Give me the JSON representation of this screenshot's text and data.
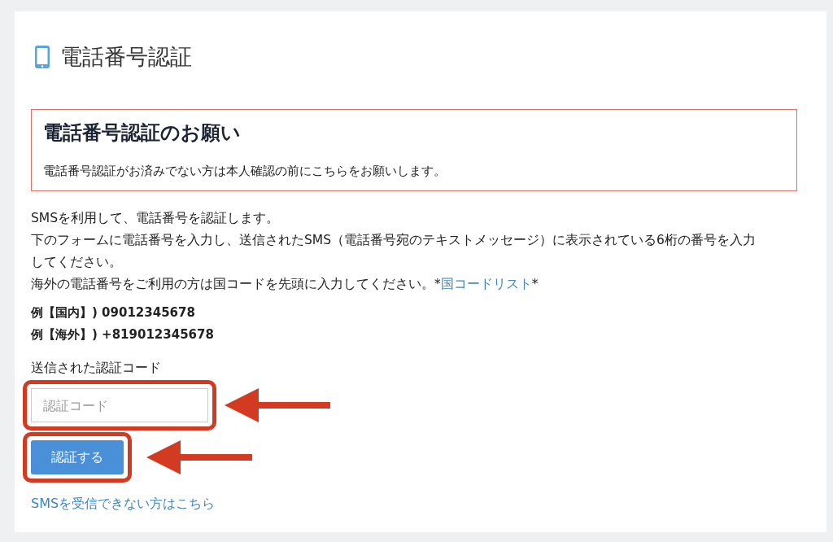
{
  "page_title": "電話番号認証",
  "notice": {
    "heading": "電話番号認証のお願い",
    "text": "電話番号認証がお済みでない方は本人確認の前にこちらをお願いします。"
  },
  "intro": [
    {
      "text": "SMSを利用して、電話番号を認証します。"
    },
    {
      "text": "下のフォームに電話番号を入力し、送信されたSMS（電話番号宛のテキストメッセージ）に表示されている6桁の番号を入力してください。"
    },
    {
      "text": "海外の電話番号をご利用の方は国コードを先頭に入力してください。*",
      "link": "国コードリスト",
      "after": "*"
    }
  ],
  "examples": [
    "例【国内】) 09012345678",
    "例【海外】) +819012345678"
  ],
  "code_field": {
    "label": "送信された認証コード",
    "placeholder": "認証コード",
    "highlighted": true,
    "arrow": true
  },
  "submit_button": {
    "label": "認証する",
    "highlighted": true,
    "arrow": true
  },
  "help_link": "SMSを受信できない方はこちら"
}
